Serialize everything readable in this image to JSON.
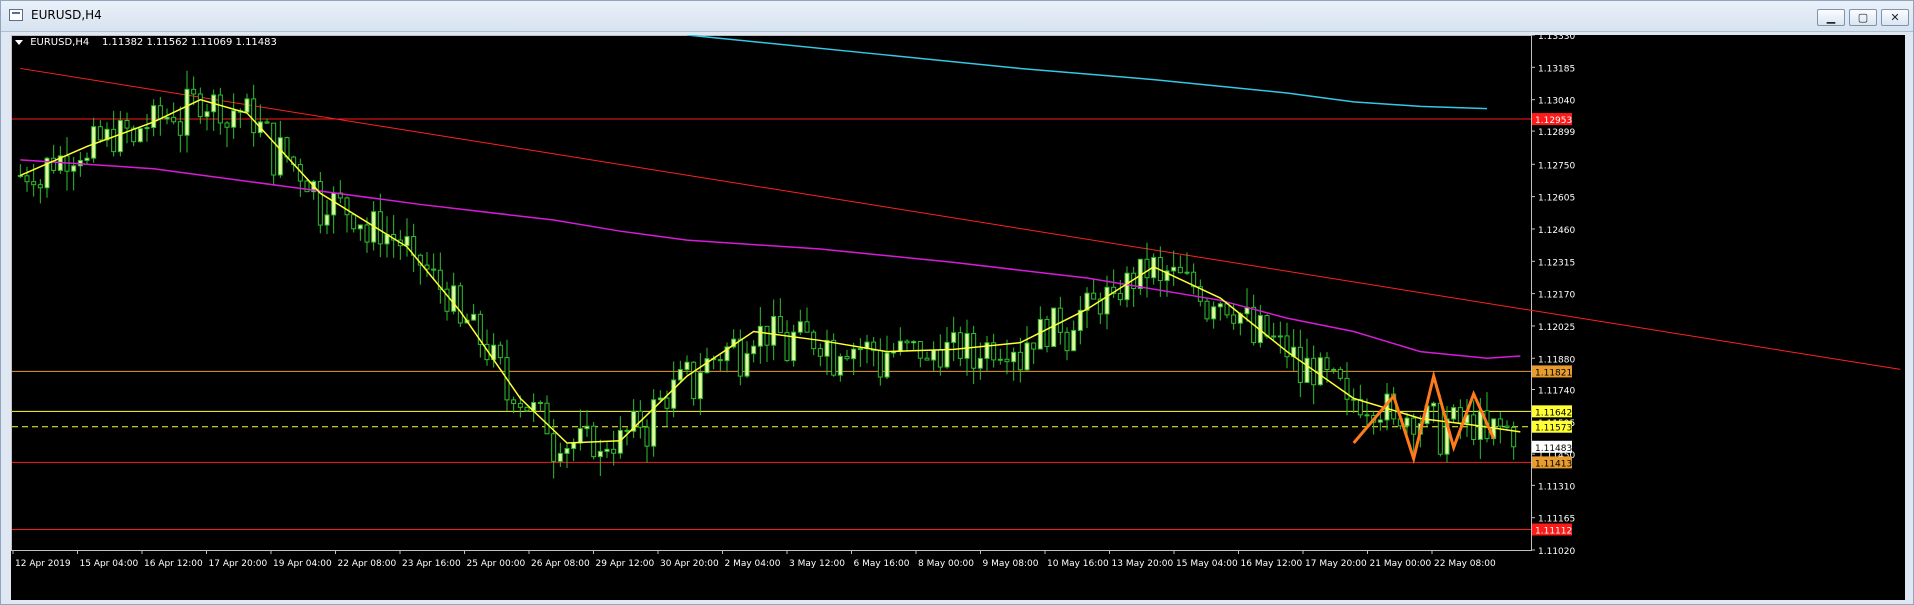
{
  "window": {
    "title": "EURUSD,H4",
    "buttons": {
      "minimize": "▁",
      "maximize": "▢",
      "close": "✕"
    }
  },
  "chart_header": {
    "symbol_tf": "EURUSD,H4",
    "ohlc": "1.11382 1.11562 1.11069 1.11483"
  },
  "colors": {
    "background": "#000000",
    "bull": "#e6f5a0",
    "bear": "#2fbf2f",
    "ma_fast": "#ffff33",
    "ma_mid": "#d81bd8",
    "ma_slow": "#33c9e6",
    "hline_red": "#ff1a1a",
    "hline_orange": "#e69c2e",
    "hline_yellow": "#ffff33",
    "pattern": "#ff7a1a",
    "trend": "#ff2020"
  },
  "chart_data": {
    "type": "candlestick",
    "y_ticks": [
      "1.13330",
      "1.13185",
      "1.13040",
      "1.12899",
      "1.12750",
      "1.12605",
      "1.12460",
      "1.12315",
      "1.12170",
      "1.12025",
      "1.11880",
      "1.11740",
      "1.11595",
      "1.11450",
      "1.11310",
      "1.11165",
      "1.11020"
    ],
    "x_ticks": [
      "12 Apr 2019",
      "15 Apr 04:00",
      "16 Apr 12:00",
      "17 Apr 20:00",
      "19 Apr 04:00",
      "22 Apr 08:00",
      "23 Apr 16:00",
      "25 Apr 00:00",
      "26 Apr 08:00",
      "29 Apr 12:00",
      "30 Apr 20:00",
      "2 May 04:00",
      "3 May 12:00",
      "6 May 16:00",
      "8 May 00:00",
      "9 May 08:00",
      "10 May 16:00",
      "13 May 20:00",
      "15 May 04:00",
      "16 May 12:00",
      "17 May 20:00",
      "21 May 00:00",
      "22 May 08:00"
    ],
    "ylim": [
      1.1102,
      1.1333
    ],
    "price_labels": [
      {
        "text": "1.12953",
        "price": 1.12953,
        "bg": "#ff1a1a",
        "fg": "#ffffff"
      },
      {
        "text": "1.11821",
        "price": 1.11821,
        "bg": "#e69c2e",
        "fg": "#000000"
      },
      {
        "text": "1.11642",
        "price": 1.11642,
        "bg": "#ffff33",
        "fg": "#000000"
      },
      {
        "text": "1.11573",
        "price": 1.11573,
        "bg": "#ffff33",
        "fg": "#000000"
      },
      {
        "text": "1.11483",
        "price": 1.11483,
        "bg": "#ffffff",
        "fg": "#000000"
      },
      {
        "text": "1.11413",
        "price": 1.11413,
        "bg": "#e69c2e",
        "fg": "#000000"
      },
      {
        "text": "1.11112",
        "price": 1.11112,
        "bg": "#ff1a1a",
        "fg": "#ffffff"
      }
    ],
    "hlines": [
      {
        "price": 1.12953,
        "color": "#ff1a1a",
        "dash": false
      },
      {
        "price": 1.11821,
        "color": "#e69c2e",
        "dash": false
      },
      {
        "price": 1.11642,
        "color": "#ffff33",
        "dash": false
      },
      {
        "price": 1.11573,
        "color": "#ffff33",
        "dash": true
      },
      {
        "price": 1.11413,
        "color": "#ff1a1a",
        "dash": false
      },
      {
        "price": 1.11112,
        "color": "#ff1a1a",
        "dash": false
      }
    ],
    "trendline": {
      "from": [
        0,
        1.1318
      ],
      "to": [
        282,
        1.1183
      ]
    },
    "ma_slow": [
      [
        100,
        1.1333
      ],
      [
        130,
        1.1324
      ],
      [
        150,
        1.1318
      ],
      [
        170,
        1.1313
      ],
      [
        190,
        1.1307
      ],
      [
        200,
        1.1303
      ],
      [
        210,
        1.1301
      ],
      [
        220,
        1.13
      ]
    ],
    "ma_mid": [
      [
        0,
        1.1277
      ],
      [
        20,
        1.1273
      ],
      [
        40,
        1.1265
      ],
      [
        60,
        1.1257
      ],
      [
        80,
        1.125
      ],
      [
        90,
        1.1245
      ],
      [
        100,
        1.1241
      ],
      [
        120,
        1.1237
      ],
      [
        140,
        1.1231
      ],
      [
        160,
        1.1224
      ],
      [
        180,
        1.1214
      ],
      [
        190,
        1.1206
      ],
      [
        200,
        1.12
      ],
      [
        210,
        1.1191
      ],
      [
        220,
        1.1188
      ],
      [
        225,
        1.1189
      ]
    ],
    "ma_fast": [
      [
        0,
        1.127
      ],
      [
        10,
        1.1283
      ],
      [
        20,
        1.1294
      ],
      [
        27,
        1.1304
      ],
      [
        34,
        1.1298
      ],
      [
        45,
        1.1262
      ],
      [
        58,
        1.1238
      ],
      [
        66,
        1.1209
      ],
      [
        75,
        1.117
      ],
      [
        82,
        1.115
      ],
      [
        90,
        1.1151
      ],
      [
        100,
        1.118
      ],
      [
        110,
        1.12
      ],
      [
        120,
        1.1196
      ],
      [
        130,
        1.1191
      ],
      [
        140,
        1.1192
      ],
      [
        150,
        1.1195
      ],
      [
        160,
        1.121
      ],
      [
        170,
        1.1229
      ],
      [
        180,
        1.1215
      ],
      [
        190,
        1.1191
      ],
      [
        200,
        1.117
      ],
      [
        210,
        1.1161
      ],
      [
        218,
        1.1158
      ],
      [
        225,
        1.1155
      ]
    ],
    "pattern": [
      [
        200,
        1.115
      ],
      [
        206,
        1.1171
      ],
      [
        209,
        1.1143
      ],
      [
        212,
        1.118
      ],
      [
        215,
        1.1148
      ],
      [
        218,
        1.1172
      ],
      [
        221,
        1.1152
      ]
    ],
    "bars": 225,
    "last_close": 1.11483
  }
}
